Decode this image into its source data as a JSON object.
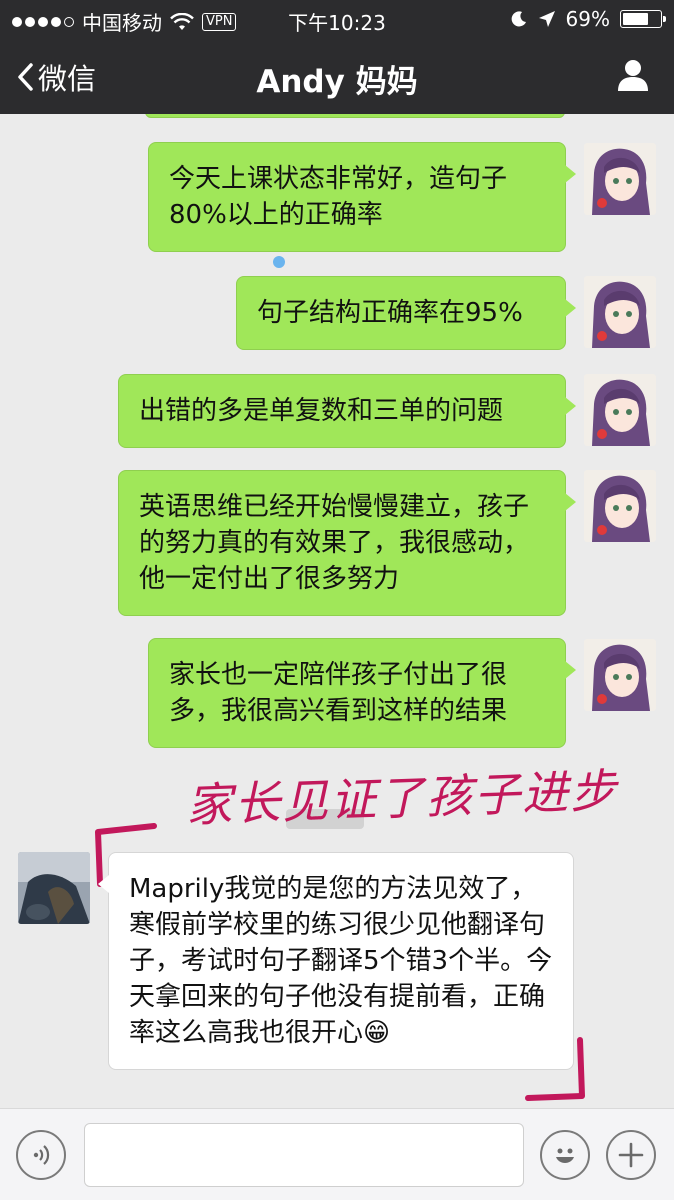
{
  "status_bar": {
    "carrier": "中国移动",
    "vpn": "VPN",
    "time": "下午10:23",
    "battery": "69%",
    "battery_level": 0.69
  },
  "nav": {
    "back_label": "微信",
    "title": "Andy 妈妈"
  },
  "messages": [
    {
      "side": "me",
      "text": "今天上课状态非常好，造句子80%以上的正确率"
    },
    {
      "side": "me",
      "text": "句子结构正确率在95%"
    },
    {
      "side": "me",
      "text": "出错的多是单复数和三单的问题"
    },
    {
      "side": "me",
      "text": "英语思维已经开始慢慢建立，孩子的努力真的有效果了，我很感动，他一定付出了很多努力"
    },
    {
      "side": "me",
      "text": "家长也一定陪伴孩子付出了很多，我很高兴看到这样的结果"
    },
    {
      "side": "other",
      "text": "Maprily我觉的是您的方法见效了，寒假前学校里的练习很少见他翻译句子，考试时句子翻译5个错3个半。今天拿回来的句子他没有提前看，正确率这么高我也很开心😁"
    }
  ],
  "annotation": "家长见证了孩子进步",
  "colors": {
    "bar": "#2c2c2e",
    "my_bubble": "#a0e759",
    "background": "#ebebeb",
    "annotation": "#c2185b"
  }
}
